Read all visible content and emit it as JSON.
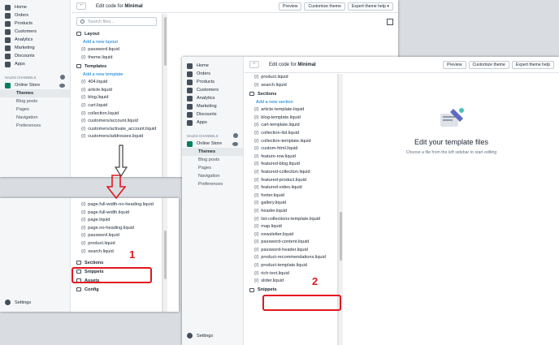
{
  "admin_nav": {
    "items": [
      {
        "label": "Home",
        "icon": "home-icon"
      },
      {
        "label": "Orders",
        "icon": "orders-icon"
      },
      {
        "label": "Products",
        "icon": "tag-icon"
      },
      {
        "label": "Customers",
        "icon": "person-icon"
      },
      {
        "label": "Analytics",
        "icon": "chart-icon"
      },
      {
        "label": "Marketing",
        "icon": "megaphone-icon"
      },
      {
        "label": "Discounts",
        "icon": "discount-icon"
      },
      {
        "label": "Apps",
        "icon": "apps-icon"
      }
    ],
    "sales_channels_label": "SALES CHANNELS",
    "online_store_label": "Online Store",
    "sub_items": [
      "Themes",
      "Blog posts",
      "Pages",
      "Navigation",
      "Preferences"
    ],
    "settings_label": "Settings"
  },
  "editor": {
    "back_label": "",
    "title_prefix": "Edit code for",
    "theme_name": "Minimal",
    "preview_label": "Preview",
    "customize_label": "Customize theme",
    "expert_label": "Expert theme help",
    "expert_label_short": "Expert theme help",
    "search_placeholder": "Search files..."
  },
  "win1_files": {
    "layout_folder": "Layout",
    "layout_add": "Add a new layout",
    "layout_files": [
      "password.liquid",
      "theme.liquid"
    ],
    "templates_folder": "Templates",
    "templates_add": "Add a new template",
    "template_files": [
      "404.liquid",
      "article.liquid",
      "blog.liquid",
      "cart.liquid",
      "collection.liquid",
      "customers/account.liquid",
      "customers/activate_account.liquid",
      "customers/addresses.liquid"
    ]
  },
  "win1b_files": {
    "files": [
      "page.full-width-no-heading.liquid",
      "page.full-width.liquid",
      "page.liquid",
      "page.no-heading.liquid",
      "password.liquid",
      "product.liquid",
      "search.liquid"
    ],
    "sections_folder": "Sections",
    "snippets_folder": "Snippets",
    "assets_folder": "Assets",
    "config_folder": "Config"
  },
  "win2_files": {
    "top_files": [
      "product.liquid",
      "search.liquid"
    ],
    "sections_folder": "Sections",
    "sections_add": "Add a new section",
    "section_files": [
      "article-template.liquid",
      "blog-template.liquid",
      "cart-template.liquid",
      "collection-list.liquid",
      "collection-template.liquid",
      "custom-html.liquid",
      "feature-row.liquid",
      "featured-blog.liquid",
      "featured-collection.liquid",
      "featured-product.liquid",
      "featured-video.liquid",
      "footer.liquid",
      "gallery.liquid",
      "header.liquid",
      "list-collections-template.liquid",
      "map.liquid",
      "newsletter.liquid",
      "password-content.liquid",
      "password-header.liquid",
      "product-recommendations.liquid",
      "product-template.liquid",
      "rich-text.liquid",
      "slider.liquid"
    ],
    "snippets_folder": "Snippets"
  },
  "empty_state": {
    "title": "Edit your template files",
    "subtitle": "Choose a file from the left sidebar to start editing"
  },
  "annotations": {
    "step1": "1",
    "step2": "2"
  },
  "colors": {
    "highlight": "#e1171e",
    "link": "#007ace",
    "nav_active": "#008060"
  }
}
